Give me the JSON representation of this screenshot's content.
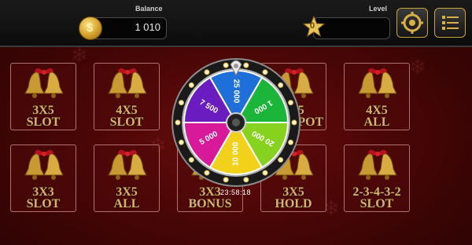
{
  "header": {
    "balance_label": "Balance",
    "balance_value": "1 010",
    "level_label": "Level",
    "level_value": "0",
    "coin_symbol": "$"
  },
  "games": [
    {
      "line1": "3X5",
      "line2": "SLOT"
    },
    {
      "line1": "4X5",
      "line2": "SLOT"
    },
    {
      "line1": "3X5",
      "line2": "JACKPOT"
    },
    {
      "line1": "4X5",
      "line2": "ALL"
    },
    {
      "line1": "3X3",
      "line2": "SLOT"
    },
    {
      "line1": "3X5",
      "line2": "ALL"
    },
    {
      "line1": "3X3",
      "line2": "BONUS"
    },
    {
      "line1": "3X5",
      "line2": "HOLD"
    },
    {
      "line1": "2-3-4-3-2",
      "line2": "SLOT"
    }
  ],
  "wheel": {
    "segments": [
      {
        "label": "25 000",
        "color": "#1e6fd8"
      },
      {
        "label": "1 000",
        "color": "#1bb53a"
      },
      {
        "label": "20 000",
        "color": "#86d21e"
      },
      {
        "label": "10 000",
        "color": "#f2d11b"
      },
      {
        "label": "5 000",
        "color": "#d8199a"
      },
      {
        "label": "7 500",
        "color": "#6a1cc0"
      }
    ],
    "timer": "23:58:18"
  },
  "colors": {
    "accent_gold": "#c9a23a",
    "background": "#4a0606"
  }
}
